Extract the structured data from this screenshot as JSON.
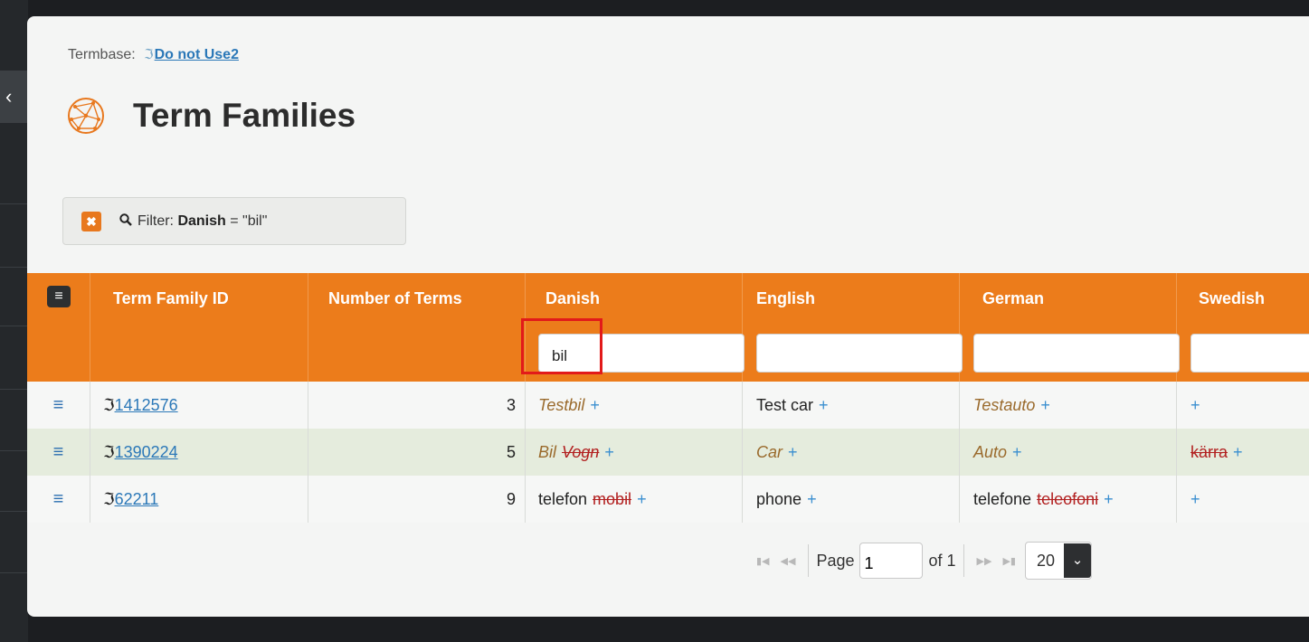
{
  "termbase": {
    "label": "Termbase:",
    "name": "Do not Use2"
  },
  "page": {
    "title": "Term Families"
  },
  "filter": {
    "prefix": "Filter:",
    "field": "Danish",
    "expr": " = \"bil\""
  },
  "columns": {
    "id": "Term Family ID",
    "count": "Number of Terms",
    "danish": "Danish",
    "english": "English",
    "german": "German",
    "swedish": "Swedish"
  },
  "column_filters": {
    "danish": "bil",
    "english": "",
    "german": "",
    "swedish": ""
  },
  "rows": [
    {
      "id": "1412576",
      "count": "3",
      "danish": [
        {
          "text": "Testbil",
          "status": "prop"
        }
      ],
      "english": [
        {
          "text": "Test car",
          "status": "ok"
        }
      ],
      "german": [
        {
          "text": "Testauto",
          "status": "prop"
        }
      ],
      "swedish": []
    },
    {
      "id": "1390224",
      "count": "5",
      "danish": [
        {
          "text": "Bil",
          "status": "prop"
        },
        {
          "text": "Vogn",
          "status": "prop-dep"
        }
      ],
      "english": [
        {
          "text": "Car",
          "status": "prop"
        }
      ],
      "german": [
        {
          "text": "Auto",
          "status": "prop"
        }
      ],
      "swedish": [
        {
          "text": "kärra",
          "status": "dep"
        }
      ]
    },
    {
      "id": "62211",
      "count": "9",
      "danish": [
        {
          "text": "telefon",
          "status": "ok"
        },
        {
          "text": "mobil",
          "status": "dep"
        }
      ],
      "english": [
        {
          "text": "phone",
          "status": "ok"
        }
      ],
      "german": [
        {
          "text": "telefone",
          "status": "ok"
        },
        {
          "text": "teleofoni",
          "status": "dep"
        }
      ],
      "swedish": []
    }
  ],
  "add_symbol": "+",
  "pager": {
    "page_label": "Page",
    "page_value": "1",
    "of_label": "of 1",
    "page_size": "20"
  },
  "colors": {
    "header": "#ec7c1b",
    "alt_row": "#e5ecdd",
    "link": "#2b78b8",
    "deprecated": "#b22020"
  }
}
